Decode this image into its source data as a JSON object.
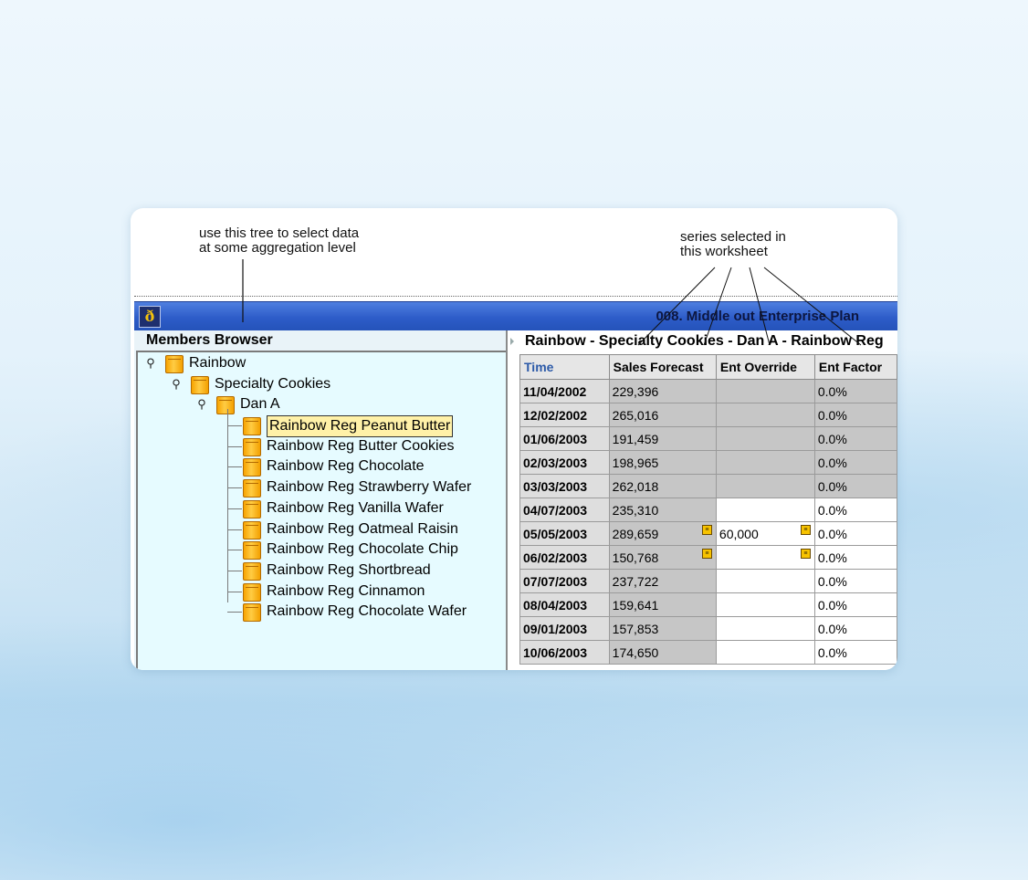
{
  "annotations": {
    "tree_note": "use this tree to select data\nat some aggregation level",
    "series_note": "series selected in\nthis worksheet"
  },
  "window": {
    "plan_title": "008. Middle out Enterprise Plan",
    "app_icon": "app-logo-icon"
  },
  "members_browser": {
    "title": "Members Browser",
    "tree": {
      "root": "Rainbow",
      "level1": "Specialty Cookies",
      "level2": "Dan A",
      "items": [
        "Rainbow Reg Peanut Butter",
        "Rainbow Reg Butter Cookies",
        "Rainbow Reg Chocolate",
        "Rainbow Reg Strawberry Wafer",
        "Rainbow Reg Vanilla Wafer",
        "Rainbow Reg Oatmeal Raisin",
        "Rainbow Reg Chocolate Chip",
        "Rainbow Reg Shortbread",
        "Rainbow Reg Cinnamon",
        "Rainbow Reg Chocolate Wafer"
      ],
      "selected_item": "Rainbow Reg Peanut Butter"
    }
  },
  "worksheet": {
    "title": "Rainbow - Specialty Cookies - Dan A - Rainbow Reg",
    "columns": [
      "Time",
      "Sales Forecast",
      "Ent Override",
      "Ent Factor"
    ],
    "rows": [
      {
        "date": "11/04/2002",
        "sales": "229,396",
        "override": "",
        "factor": "0.0%",
        "editable": false,
        "sales_flag": false,
        "override_flag": false
      },
      {
        "date": "12/02/2002",
        "sales": "265,016",
        "override": "",
        "factor": "0.0%",
        "editable": false,
        "sales_flag": false,
        "override_flag": false
      },
      {
        "date": "01/06/2003",
        "sales": "191,459",
        "override": "",
        "factor": "0.0%",
        "editable": false,
        "sales_flag": false,
        "override_flag": false
      },
      {
        "date": "02/03/2003",
        "sales": "198,965",
        "override": "",
        "factor": "0.0%",
        "editable": false,
        "sales_flag": false,
        "override_flag": false
      },
      {
        "date": "03/03/2003",
        "sales": "262,018",
        "override": "",
        "factor": "0.0%",
        "editable": false,
        "sales_flag": false,
        "override_flag": false
      },
      {
        "date": "04/07/2003",
        "sales": "235,310",
        "override": "",
        "factor": "0.0%",
        "editable": true,
        "sales_flag": false,
        "override_flag": false
      },
      {
        "date": "05/05/2003",
        "sales": "289,659",
        "override": "60,000",
        "factor": "0.0%",
        "editable": true,
        "sales_flag": true,
        "override_flag": true
      },
      {
        "date": "06/02/2003",
        "sales": "150,768",
        "override": "",
        "factor": "0.0%",
        "editable": true,
        "sales_flag": true,
        "override_flag": true
      },
      {
        "date": "07/07/2003",
        "sales": "237,722",
        "override": "",
        "factor": "0.0%",
        "editable": true,
        "sales_flag": false,
        "override_flag": false
      },
      {
        "date": "08/04/2003",
        "sales": "159,641",
        "override": "",
        "factor": "0.0%",
        "editable": true,
        "sales_flag": false,
        "override_flag": false
      },
      {
        "date": "09/01/2003",
        "sales": "157,853",
        "override": "",
        "factor": "0.0%",
        "editable": true,
        "sales_flag": false,
        "override_flag": false
      },
      {
        "date": "10/06/2003",
        "sales": "174,650",
        "override": "",
        "factor": "0.0%",
        "editable": true,
        "sales_flag": false,
        "override_flag": false
      }
    ]
  },
  "icons": {
    "tree_node": "cube-icon",
    "expander": "key-expander-icon",
    "note_flag": "note-flag-icon"
  }
}
